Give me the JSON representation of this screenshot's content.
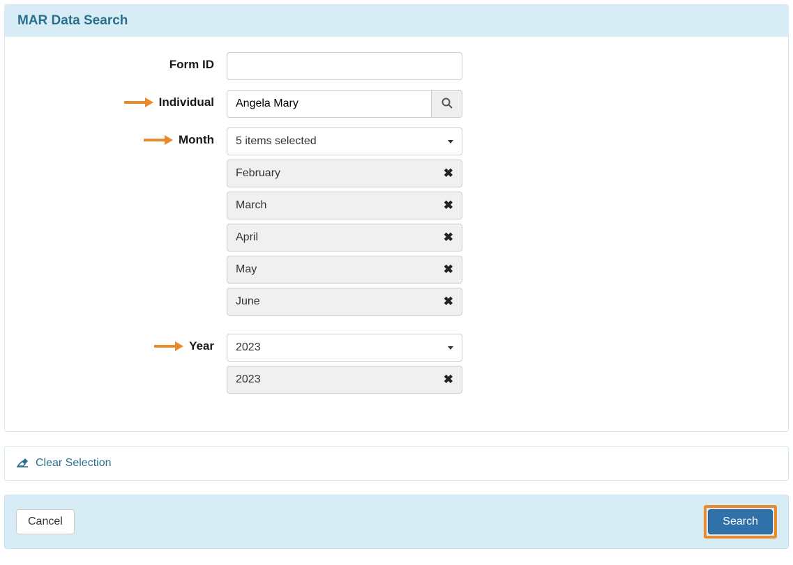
{
  "panel": {
    "title": "MAR Data Search"
  },
  "form": {
    "form_id": {
      "label": "Form ID",
      "value": ""
    },
    "individual": {
      "label": "Individual",
      "value": "Angela Mary"
    },
    "month": {
      "label": "Month",
      "summary": "5 items selected",
      "selected": [
        "February",
        "March",
        "April",
        "May",
        "June"
      ]
    },
    "year": {
      "label": "Year",
      "summary": "2023",
      "selected": [
        "2023"
      ]
    }
  },
  "clear": {
    "label": "Clear Selection"
  },
  "actions": {
    "cancel": "Cancel",
    "search": "Search"
  },
  "annotations": {
    "arrow_color": "#e98b2c",
    "highlight_color": "#e98b2c"
  }
}
